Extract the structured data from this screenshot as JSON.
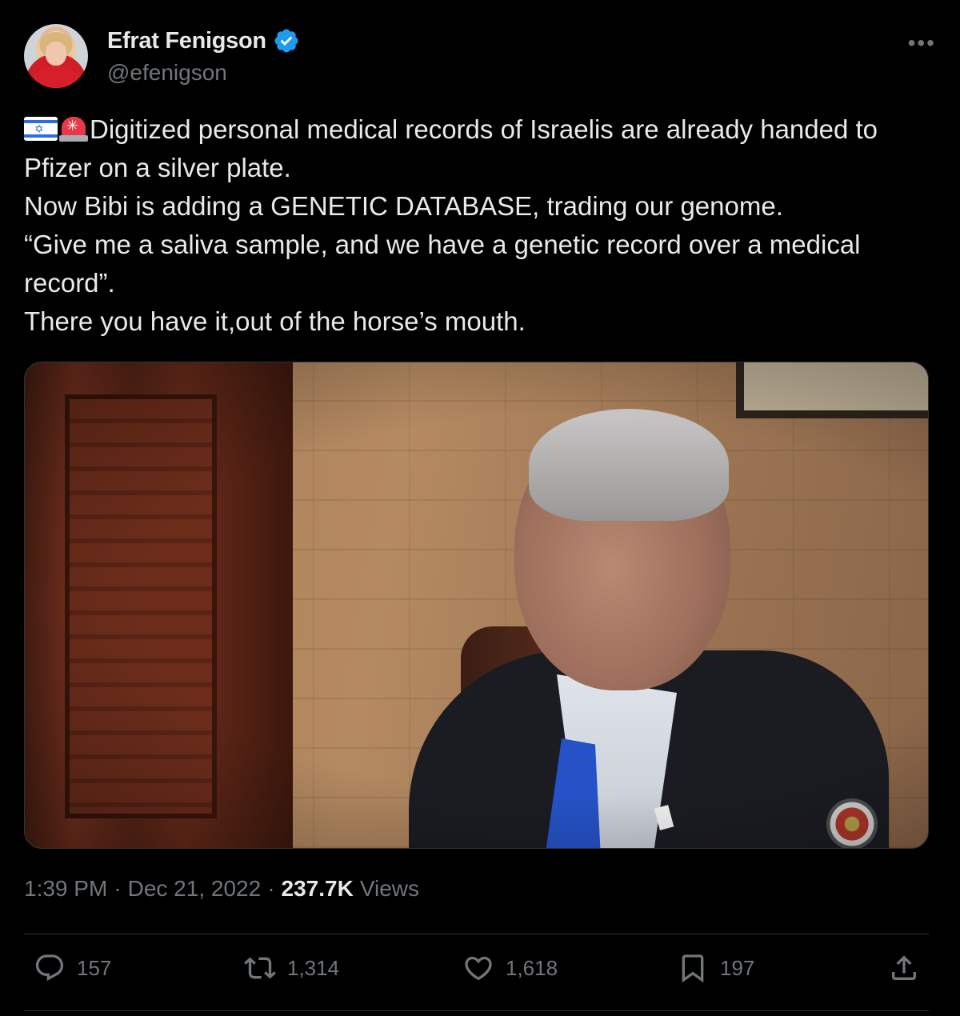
{
  "author": {
    "display_name": "Efrat Fenigson",
    "handle": "@efenigson",
    "verified": true
  },
  "tweet": {
    "leading_emojis": [
      "israel-flag",
      "police-siren"
    ],
    "text": "Digitized personal medical records of Israelis are already handed to Pfizer on a silver plate.\nNow Bibi is adding a GENETIC DATABASE, trading our genome.\n“Give me a saliva sample, and we have a genetic record over a medical record”.\nThere you have it,out of the horse’s mouth."
  },
  "meta": {
    "time": "1:39 PM",
    "separator": "·",
    "date": "Dec 21, 2022",
    "views_count": "237.7K",
    "views_label": "Views"
  },
  "actions": {
    "replies": "157",
    "retweets": "1,314",
    "likes": "1,618",
    "bookmarks": "197"
  },
  "icons": {
    "more": "more-icon",
    "reply": "reply-icon",
    "retweet": "retweet-icon",
    "like": "heart-icon",
    "bookmark": "bookmark-icon",
    "share": "share-icon"
  },
  "colors": {
    "background": "#000000",
    "text_primary": "#e7e9ea",
    "text_secondary": "#71767b",
    "verified_badge": "#1d9bf0",
    "divider": "#2f3336"
  }
}
